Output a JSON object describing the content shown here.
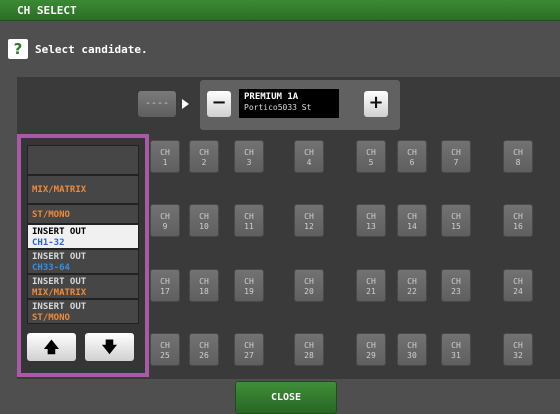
{
  "window": {
    "title": "CH SELECT"
  },
  "prompt": {
    "icon": "help-icon",
    "icon_glyph": "?",
    "text": "Select candidate."
  },
  "selector": {
    "source_label": "----",
    "minus_label": "−",
    "plus_label": "+",
    "channel_name": "PREMIUM 1A",
    "channel_sub": "Portico5033 St"
  },
  "categories": [
    {
      "label": "",
      "line2": ""
    },
    {
      "label": "MIX/MATRIX",
      "line2": ""
    },
    {
      "label": "ST/MONO",
      "line2": ""
    },
    {
      "label": "INSERT OUT",
      "line2": "CH1-32",
      "selected": true
    },
    {
      "label": "INSERT OUT",
      "line2": "CH33-64"
    },
    {
      "label": "INSERT OUT",
      "line2": "MIX/MATRIX"
    },
    {
      "label": "INSERT OUT",
      "line2": "ST/MONO"
    }
  ],
  "scroll": {
    "up_glyph": "🡅",
    "down_glyph": "🡇"
  },
  "channels": [
    [
      "CH",
      "1"
    ],
    [
      "CH",
      "2"
    ],
    [
      "CH",
      "3"
    ],
    [
      "CH",
      "4"
    ],
    [
      "CH",
      "5"
    ],
    [
      "CH",
      "6"
    ],
    [
      "CH",
      "7"
    ],
    [
      "CH",
      "8"
    ],
    [
      "CH",
      "9"
    ],
    [
      "CH",
      "10"
    ],
    [
      "CH",
      "11"
    ],
    [
      "CH",
      "12"
    ],
    [
      "CH",
      "13"
    ],
    [
      "CH",
      "14"
    ],
    [
      "CH",
      "15"
    ],
    [
      "CH",
      "16"
    ],
    [
      "CH",
      "17"
    ],
    [
      "CH",
      "18"
    ],
    [
      "CH",
      "19"
    ],
    [
      "CH",
      "20"
    ],
    [
      "CH",
      "21"
    ],
    [
      "CH",
      "22"
    ],
    [
      "CH",
      "23"
    ],
    [
      "CH",
      "24"
    ],
    [
      "CH",
      "25"
    ],
    [
      "CH",
      "26"
    ],
    [
      "CH",
      "27"
    ],
    [
      "CH",
      "28"
    ],
    [
      "CH",
      "29"
    ],
    [
      "CH",
      "30"
    ],
    [
      "CH",
      "31"
    ],
    [
      "CH",
      "32"
    ]
  ],
  "footer": {
    "close_label": "CLOSE"
  },
  "colors": {
    "accent_green": "#2f7b2a",
    "selection_frame": "#a85aa8",
    "orange_label": "#f08a3a",
    "blue_label": "#2a65d8"
  }
}
